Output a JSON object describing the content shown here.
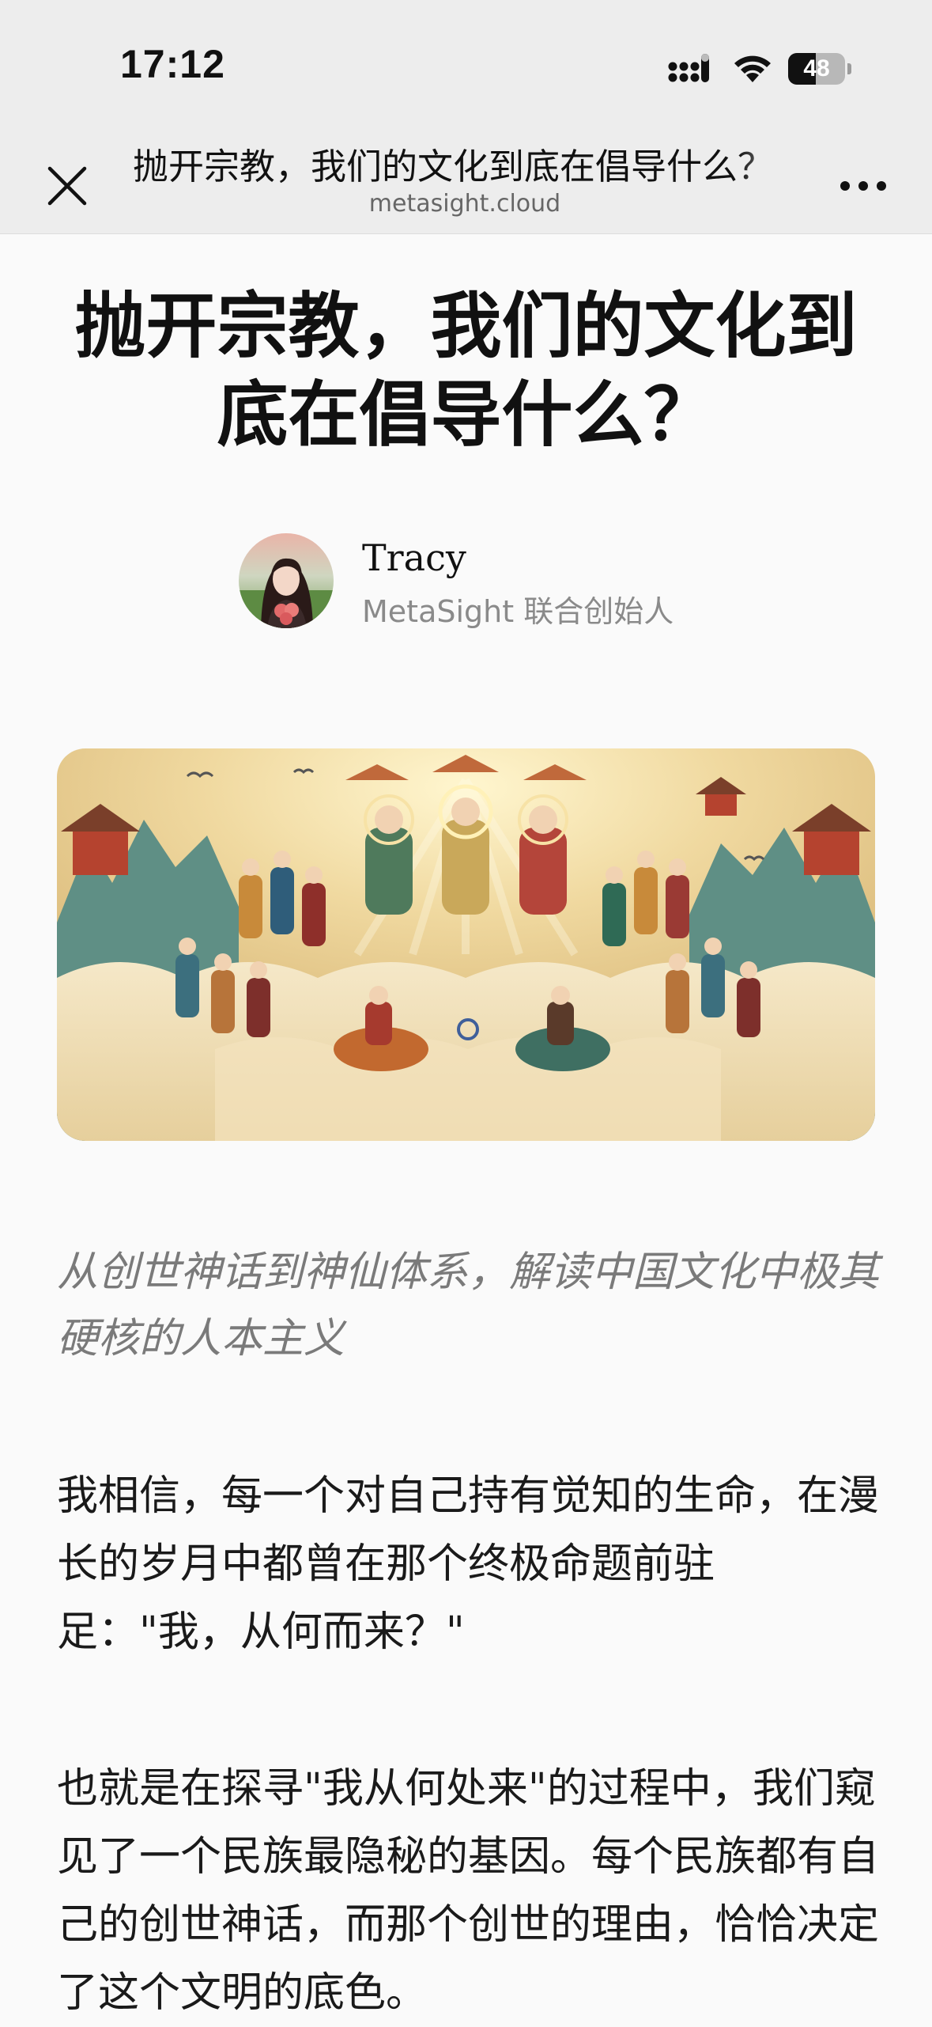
{
  "status_bar": {
    "time": "17:12",
    "battery_level": "48",
    "battery_fraction": 0.48,
    "icons": [
      "signal-icon",
      "wifi-icon",
      "battery-icon"
    ]
  },
  "nav": {
    "title": "抛开宗教，我们的文化到底在倡导什么？",
    "domain": "metasight.cloud",
    "icons": [
      "close-icon",
      "more-icon"
    ]
  },
  "article": {
    "title": "抛开宗教，我们的文化到底在倡导什么？",
    "author": {
      "name": "Tracy",
      "role": "MetaSight 联合创始人"
    },
    "subtitle": "从创世神话到神仙体系，解读中国文化中极其硬核的人本主义",
    "paragraphs": [
      "我相信，每一个对自己持有觉知的生命，在漫长的岁月中都曾在那个终极命题前驻足：\"我，从何而来？\"",
      "也就是在探寻\"我从何处来\"的过程中，我们窥见了一个民族最隐秘的基因。每个民族都有自己的创世神话，而那个创世的理由，恰恰决定了这个文明的底色。"
    ]
  },
  "colors": {
    "page_background": "#fafafa",
    "chrome_background": "#ededed",
    "text": "#111111",
    "muted_text": "#8a8a8a"
  }
}
